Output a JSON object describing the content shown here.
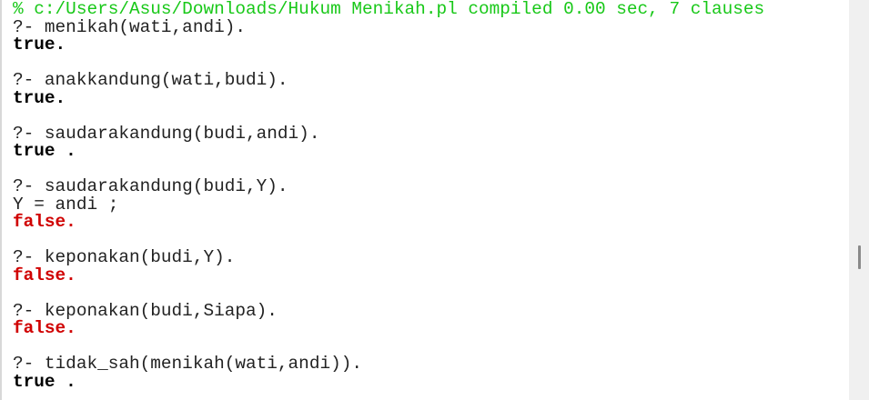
{
  "console": {
    "lines": [
      {
        "type": "comment",
        "text": "% c:/Users/Asus/Downloads/Hukum Menikah.pl compiled 0.00 sec, 7 clauses"
      },
      {
        "type": "query",
        "text": "?- menikah(wati,andi)."
      },
      {
        "type": "ans",
        "text": "true."
      },
      {
        "type": "blank",
        "text": ""
      },
      {
        "type": "query",
        "text": "?- anakkandung(wati,budi)."
      },
      {
        "type": "ans",
        "text": "true."
      },
      {
        "type": "blank",
        "text": ""
      },
      {
        "type": "query",
        "text": "?- saudarakandung(budi,andi)."
      },
      {
        "type": "ans",
        "text": "true ."
      },
      {
        "type": "blank",
        "text": ""
      },
      {
        "type": "query",
        "text": "?- saudarakandung(budi,Y)."
      },
      {
        "type": "query",
        "text": "Y = andi ;"
      },
      {
        "type": "false",
        "text": "false."
      },
      {
        "type": "blank",
        "text": ""
      },
      {
        "type": "query",
        "text": "?- keponakan(budi,Y)."
      },
      {
        "type": "false",
        "text": "false."
      },
      {
        "type": "blank",
        "text": ""
      },
      {
        "type": "query",
        "text": "?- keponakan(budi,Siapa)."
      },
      {
        "type": "false",
        "text": "false."
      },
      {
        "type": "blank",
        "text": ""
      },
      {
        "type": "query",
        "text": "?- tidak_sah(menikah(wati,andi))."
      },
      {
        "type": "ans",
        "text": "true ."
      }
    ]
  },
  "colors": {
    "comment": "#18c818",
    "false": "#d00000",
    "true": "#000000"
  },
  "scrollbar": {
    "position_fraction": 0.64
  }
}
